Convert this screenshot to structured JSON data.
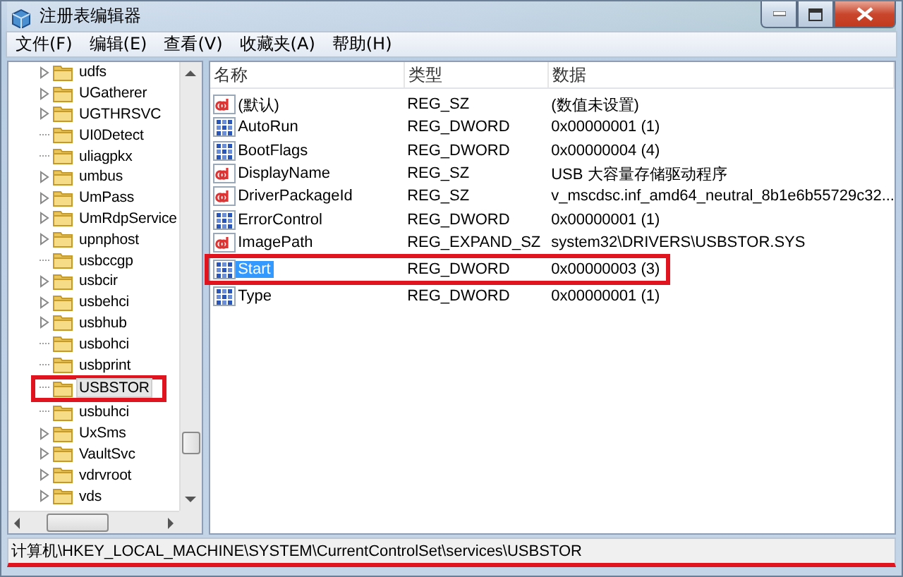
{
  "window": {
    "title": "注册表编辑器"
  },
  "menu": [
    "文件(F)",
    "编辑(E)",
    "查看(V)",
    "收藏夹(A)",
    "帮助(H)"
  ],
  "tree": {
    "items": [
      {
        "label": "udfs",
        "expandable": true,
        "selected": false,
        "highlighted": false
      },
      {
        "label": "UGatherer",
        "expandable": true,
        "selected": false,
        "highlighted": false
      },
      {
        "label": "UGTHRSVC",
        "expandable": true,
        "selected": false,
        "highlighted": false
      },
      {
        "label": "UI0Detect",
        "expandable": false,
        "selected": false,
        "highlighted": false
      },
      {
        "label": "uliagpkx",
        "expandable": false,
        "selected": false,
        "highlighted": false
      },
      {
        "label": "umbus",
        "expandable": true,
        "selected": false,
        "highlighted": false
      },
      {
        "label": "UmPass",
        "expandable": true,
        "selected": false,
        "highlighted": false
      },
      {
        "label": "UmRdpService",
        "expandable": true,
        "selected": false,
        "highlighted": false
      },
      {
        "label": "upnphost",
        "expandable": true,
        "selected": false,
        "highlighted": false
      },
      {
        "label": "usbccgp",
        "expandable": false,
        "selected": false,
        "highlighted": false
      },
      {
        "label": "usbcir",
        "expandable": true,
        "selected": false,
        "highlighted": false
      },
      {
        "label": "usbehci",
        "expandable": true,
        "selected": false,
        "highlighted": false
      },
      {
        "label": "usbhub",
        "expandable": true,
        "selected": false,
        "highlighted": false
      },
      {
        "label": "usbohci",
        "expandable": false,
        "selected": false,
        "highlighted": false
      },
      {
        "label": "usbprint",
        "expandable": false,
        "selected": false,
        "highlighted": false
      },
      {
        "label": "USBSTOR",
        "expandable": false,
        "selected": true,
        "highlighted": true
      },
      {
        "label": "usbuhci",
        "expandable": false,
        "selected": false,
        "highlighted": false
      },
      {
        "label": "UxSms",
        "expandable": true,
        "selected": false,
        "highlighted": false
      },
      {
        "label": "VaultSvc",
        "expandable": true,
        "selected": false,
        "highlighted": false
      },
      {
        "label": "vdrvroot",
        "expandable": true,
        "selected": false,
        "highlighted": false
      },
      {
        "label": "vds",
        "expandable": true,
        "selected": false,
        "highlighted": false
      }
    ]
  },
  "values": {
    "columns": [
      "名称",
      "类型",
      "数据"
    ],
    "rows": [
      {
        "kind": "string",
        "name": "(默认)",
        "type": "REG_SZ",
        "data": "(数值未设置)",
        "selected": false,
        "highlighted": false
      },
      {
        "kind": "number",
        "name": "AutoRun",
        "type": "REG_DWORD",
        "data": "0x00000001 (1)",
        "selected": false,
        "highlighted": false
      },
      {
        "kind": "number",
        "name": "BootFlags",
        "type": "REG_DWORD",
        "data": "0x00000004 (4)",
        "selected": false,
        "highlighted": false
      },
      {
        "kind": "string",
        "name": "DisplayName",
        "type": "REG_SZ",
        "data": "USB 大容量存储驱动程序",
        "selected": false,
        "highlighted": false
      },
      {
        "kind": "string",
        "name": "DriverPackageId",
        "type": "REG_SZ",
        "data": "v_mscdsc.inf_amd64_neutral_8b1e6b55729c32...",
        "selected": false,
        "highlighted": false
      },
      {
        "kind": "number",
        "name": "ErrorControl",
        "type": "REG_DWORD",
        "data": "0x00000001 (1)",
        "selected": false,
        "highlighted": false
      },
      {
        "kind": "string",
        "name": "ImagePath",
        "type": "REG_EXPAND_SZ",
        "data": "system32\\DRIVERS\\USBSTOR.SYS",
        "selected": false,
        "highlighted": false
      },
      {
        "kind": "number",
        "name": "Start",
        "type": "REG_DWORD",
        "data": "0x00000003 (3)",
        "selected": true,
        "highlighted": true
      },
      {
        "kind": "number",
        "name": "Type",
        "type": "REG_DWORD",
        "data": "0x00000001 (1)",
        "selected": false,
        "highlighted": false
      }
    ]
  },
  "status_bar": {
    "text": "计算机\\HKEY_LOCAL_MACHINE\\SYSTEM\\CurrentControlSet\\services\\USBSTOR",
    "highlighted": true
  }
}
